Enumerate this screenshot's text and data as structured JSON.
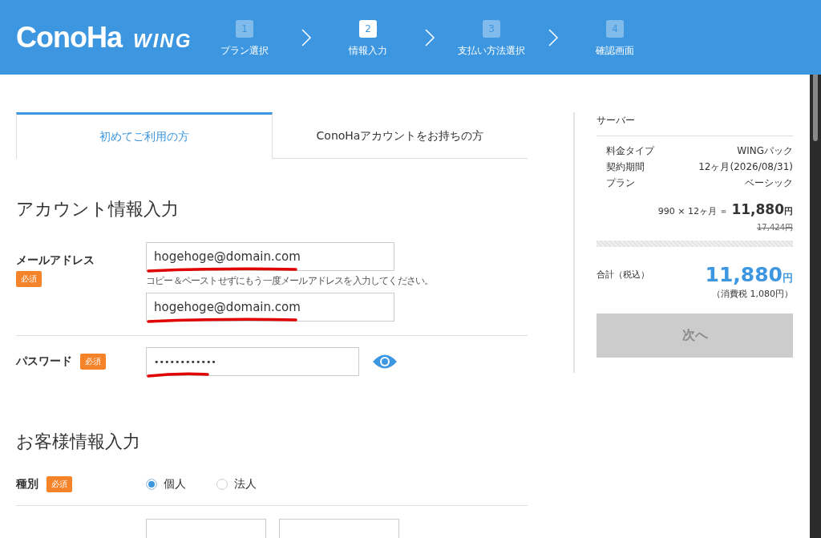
{
  "header": {
    "logo": "ConoHa",
    "product": "WING",
    "steps": [
      {
        "number": "1",
        "label": "プラン選択",
        "selected": false
      },
      {
        "number": "2",
        "label": "情報入力",
        "selected": true
      },
      {
        "number": "3",
        "label": "支払い方法選択",
        "selected": false
      },
      {
        "number": "4",
        "label": "確認画面",
        "selected": false
      }
    ]
  },
  "tabs": [
    {
      "label": "初めてご利用の方",
      "selected": true
    },
    {
      "label": "ConoHaアカウントをお持ちの方",
      "selected": false
    }
  ],
  "account_section": {
    "title": "アカウント情報入力",
    "email": {
      "label": "メールアドレス",
      "required": "必須",
      "value": "hogehoge@domain.com",
      "hint": "コピー＆ペーストせずにもう一度メールアドレスを入力してください。",
      "confirm_value": "hogehoge@domain.com"
    },
    "password": {
      "label": "パスワード",
      "required": "必須",
      "value": "••••••••••••"
    }
  },
  "customer_section": {
    "title": "お客様情報入力",
    "type_field": {
      "label": "種別",
      "required": "必須",
      "options": [
        {
          "label": "個人",
          "selected": true
        },
        {
          "label": "法人",
          "selected": false
        }
      ]
    }
  },
  "summary": {
    "title": "サーバー",
    "rows": [
      {
        "label": "料金タイプ",
        "value": "WINGパック"
      },
      {
        "label": "契約期間",
        "value": "12ヶ月(2026/08/31)"
      },
      {
        "label": "プラン",
        "value": "ベーシック"
      }
    ],
    "formula": "990 × 12ヶ月 ＝",
    "price": "11,880",
    "price_unit": "円",
    "old_price": "17,424円",
    "total_label": "合計（税込）",
    "total": "11,880",
    "total_unit": "円",
    "tax": "（消費税 1,080円）",
    "next_button": {
      "label": "次へ",
      "disabled": true
    }
  }
}
